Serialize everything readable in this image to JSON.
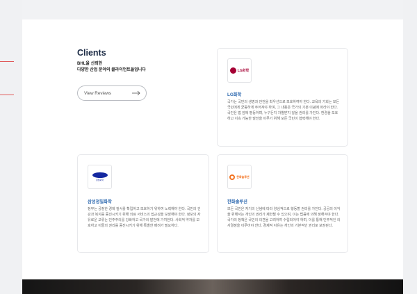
{
  "section": {
    "title": "Clients",
    "subtitle_line1": "BHL을 신뢰한",
    "subtitle_line2": "다양한 산업 분야의 클라이언트들입니다",
    "button_label": "View Reviews"
  },
  "clients": [
    {
      "name": "LG화학",
      "logo_text": "LG화학",
      "description": "국가는 국민의 생명과 안전을 최우선으로 보호하여야 한다. 교육의 기회는 모든 국민에게 균등하게 주어져야 하며, 그 내용은 국가의 기본 이념에 따라야 한다. 국민은 법 앞에 평등하며, 누구든지 차별받지 않을 권리를 가진다. 환경을 보호하고 지속 가능한 발전을 이루기 위해 모든 국민이 협력해야 한다."
    },
    {
      "name": "삼성정밀화학",
      "logo_text": "정밀화학",
      "description": "정부는 공정한 경제 질서를 확립하고 보호하기 위하여 노력해야 한다. 국민의 건강과 복지를 증진시키기 위해 의료 서비스의 접근성을 보장해야 한다. 정보의 자유로운 교류는 민주주의를 강화하고 국가의 발전에 기여한다. 사회적 약자를 보호하고 이들의 권리를 증진시키기 위해 특별한 배려가 필요하다."
    },
    {
      "name": "한화솔루션",
      "logo_text": "한화솔루션",
      "description": "모든 국민은 자기의 신념에 따라 양심적으로 행동할 권리를 가진다. 공공의 이익을 위해서는 개인의 권리가 제한될 수 있으며, 이는 법률에 의해 정해져야 한다. 국가의 정책은 국민의 의견을 고려하여 수립되어야 하며, 이를 통해 민주적인 의사결정을 이루어야 한다. 경제적 자유는 개인의 기본적인 권리로 보장된다."
    }
  ],
  "colors": {
    "title": "#1b2a44",
    "client_name": "#2f6ab0",
    "side_line": "#e05a5a"
  }
}
